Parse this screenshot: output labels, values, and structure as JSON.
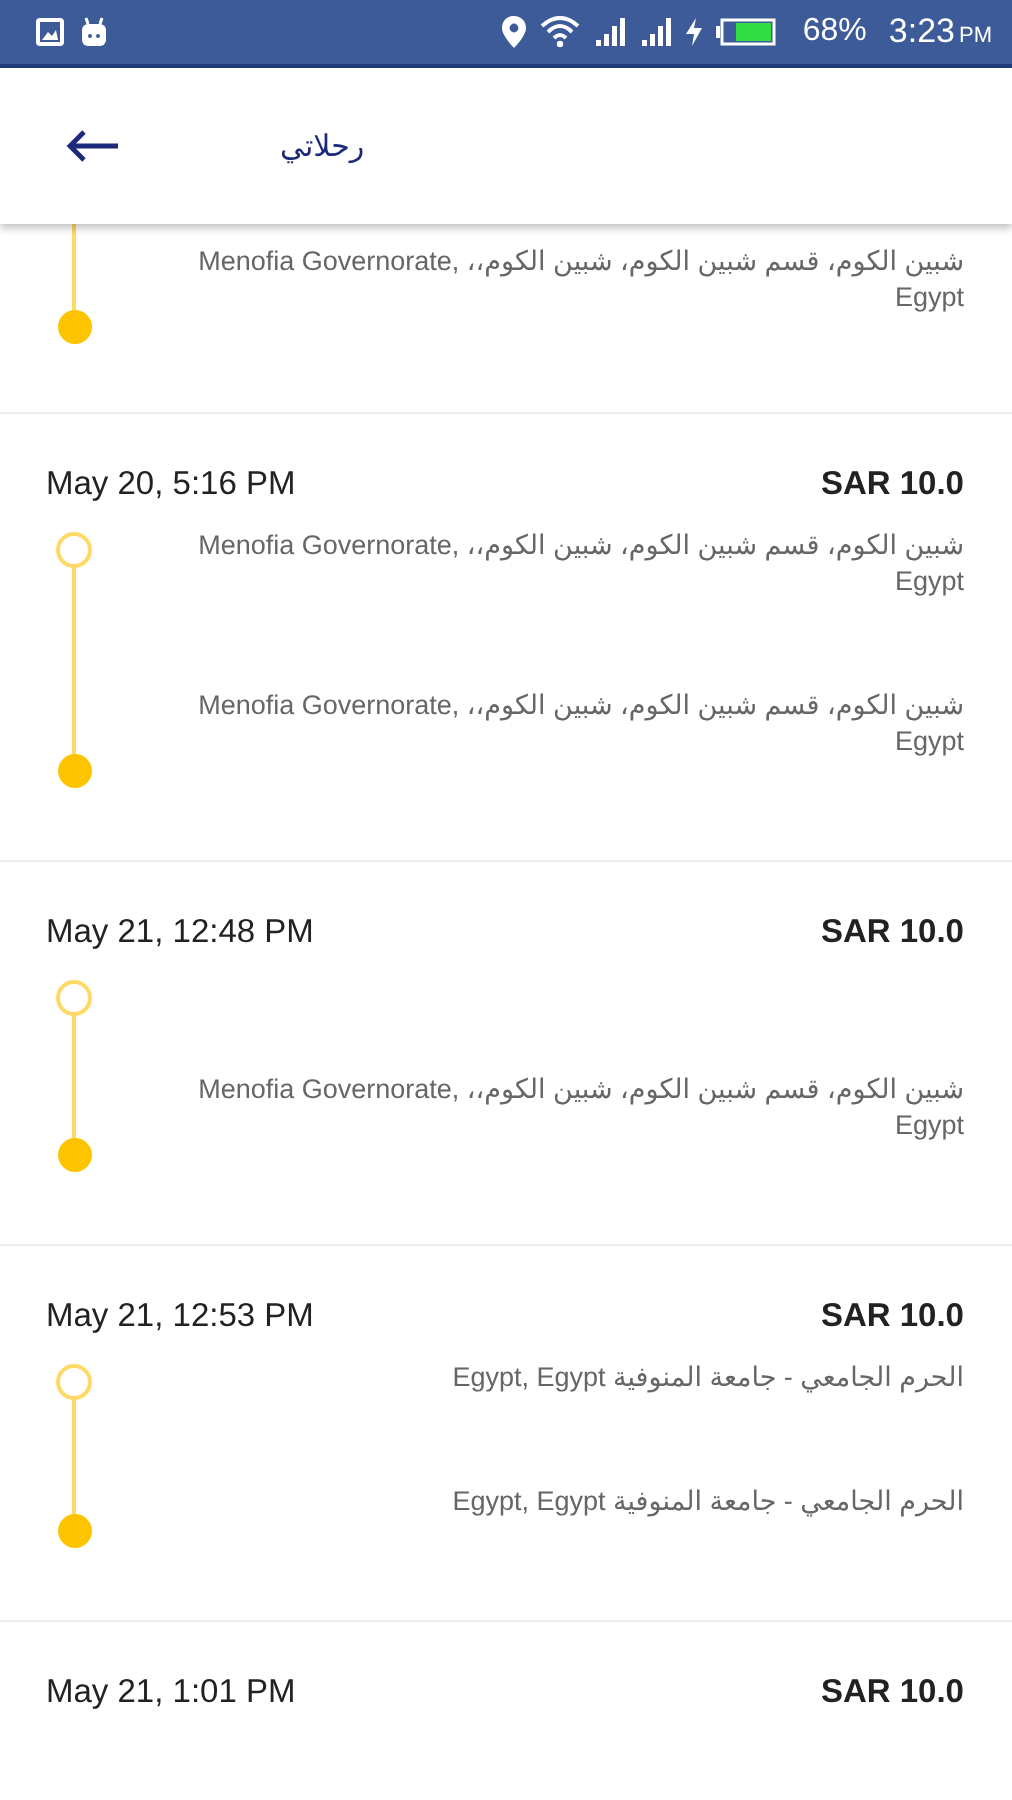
{
  "status_bar": {
    "battery": "68%",
    "time": "3:23",
    "time_suffix": "PM"
  },
  "app_bar": {
    "title": "رحلاتي"
  },
  "trips": [
    {
      "stops": [
        {
          "kind": "dropoff",
          "address": "شبين الكوم، قسم شبين الكوم، شبين الكوم،، Menofia Governorate, Egypt"
        }
      ]
    },
    {
      "date": "May 20, 5:16 PM",
      "price": "SAR 10.0",
      "stops": [
        {
          "kind": "pickup",
          "address": "شبين الكوم، قسم شبين الكوم، شبين الكوم،، Menofia Governorate, Egypt"
        },
        {
          "kind": "dropoff",
          "address": "شبين الكوم، قسم شبين الكوم، شبين الكوم،، Menofia Governorate, Egypt"
        }
      ]
    },
    {
      "date": "May 21, 12:48 PM",
      "price": "SAR 10.0",
      "stops": [
        {
          "kind": "pickup"
        },
        {
          "kind": "dropoff",
          "address": "شبين الكوم، قسم شبين الكوم، شبين الكوم،، Menofia Governorate, Egypt"
        }
      ]
    },
    {
      "date": "May 21, 12:53 PM",
      "price": "SAR 10.0",
      "stops": [
        {
          "kind": "pickup",
          "address": "الحرم الجامعي - جامعة المنوفية Egypt, Egypt"
        },
        {
          "kind": "dropoff",
          "address": "الحرم الجامعي - جامعة المنوفية Egypt, Egypt"
        }
      ]
    },
    {
      "date": "May 21, 1:01 PM",
      "price": "SAR 10.0"
    }
  ]
}
